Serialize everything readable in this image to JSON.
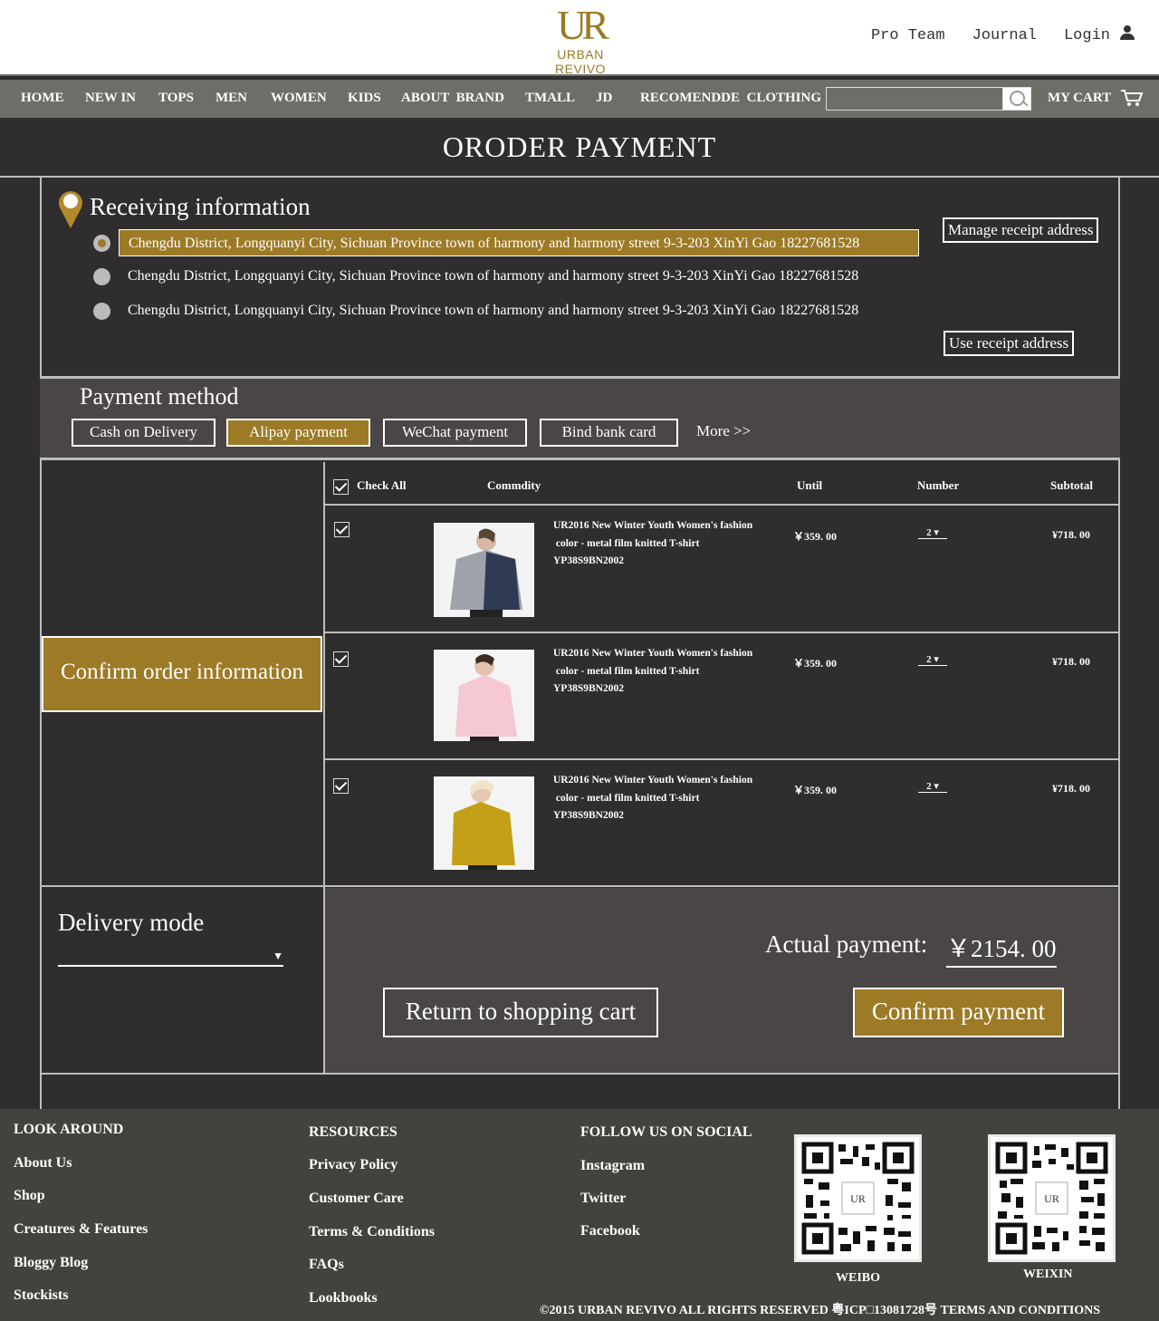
{
  "brand": {
    "logo_mark": "UR",
    "logo_name": "URBAN REVIVO",
    "accent_color": "#9d7a25"
  },
  "top_links": {
    "pro_team": "Pro Team",
    "journal": "Journal",
    "login": "Login"
  },
  "nav": {
    "items": [
      "HOME",
      "NEW IN",
      "TOPS",
      "MEN",
      "WOMEN",
      "KIDS",
      "ABOUT  BRAND",
      "TMALL",
      "JD",
      "RECOMENDDE  CLOTHING"
    ],
    "search_value": "",
    "cart_label": "MY CART"
  },
  "page_title": "ORODER PAYMENT",
  "receiving": {
    "title": "Receiving information",
    "addresses": [
      {
        "text": "Chengdu District, Longquanyi City, Sichuan Province town of harmony and harmony street 9-3-203 XinYi Gao 18227681528",
        "selected": true
      },
      {
        "text": "Chengdu District, Longquanyi City, Sichuan Province town of harmony and harmony street 9-3-203 XinYi Gao 18227681528",
        "selected": false
      },
      {
        "text": "Chengdu District, Longquanyi City, Sichuan Province town of harmony and harmony street 9-3-203 XinYi Gao 18227681528",
        "selected": false
      }
    ],
    "manage_label": "Manage receipt address",
    "use_label": "Use receipt address"
  },
  "payment": {
    "title": "Payment method",
    "methods": [
      "Cash on Delivery",
      "Alipay payment",
      "WeChat payment",
      "Bind bank card"
    ],
    "selected_method": "Alipay payment",
    "more_label": "More >>"
  },
  "order": {
    "confirm_label": "Confirm order information",
    "headers": {
      "check_all": "Check All",
      "commodity": "Commdity",
      "unit": "Until",
      "number": "Number",
      "subtotal": "Subtotal"
    },
    "items": [
      {
        "name_line1": "UR2016 New Winter Youth Women's fashion",
        "name_line2": " color - metal film knitted T-shirt",
        "sku": "YP38S9BN2002",
        "unit_price": "￥359. 00",
        "quantity": "2",
        "subtotal": "¥718. 00",
        "checked": true
      },
      {
        "name_line1": "UR2016 New Winter Youth Women's fashion",
        "name_line2": " color - metal film knitted T-shirt",
        "sku": "YP38S9BN2002",
        "unit_price": "￥359. 00",
        "quantity": "2",
        "subtotal": "¥718. 00",
        "checked": true
      },
      {
        "name_line1": "UR2016 New Winter Youth Women's fashion",
        "name_line2": " color - metal film knitted T-shirt",
        "sku": "YP38S9BN2002",
        "unit_price": "￥359. 00",
        "quantity": "2",
        "subtotal": "¥718. 00",
        "checked": true
      }
    ]
  },
  "delivery": {
    "title": "Delivery mode",
    "value": ""
  },
  "totals": {
    "actual_label": "Actual payment:",
    "actual_value": "￥2154. 00"
  },
  "actions": {
    "return_label": "Return to shopping cart",
    "confirm_label": "Confirm payment"
  },
  "footer": {
    "look_around": {
      "title": "LOOK AROUND",
      "links": [
        "About Us",
        "Shop",
        "Creatures & Features",
        "Bloggy Blog",
        "Stockists"
      ]
    },
    "resources": {
      "title": "RESOURCES",
      "links": [
        "Privacy Policy",
        "Customer Care",
        "Terms & Conditions",
        "FAQs",
        "Lookbooks"
      ]
    },
    "social": {
      "title": "FOLLOW US ON SOCIAL",
      "links": [
        "Instagram",
        "Twitter",
        "Facebook"
      ]
    },
    "qr_labels": [
      "WEIBO",
      "WEIXIN"
    ],
    "copyright": "©2015 URBAN REVIVO ALL RIGHTS RESERVED 粤ICP□13081728号 TERMS AND CONDITIONS"
  }
}
